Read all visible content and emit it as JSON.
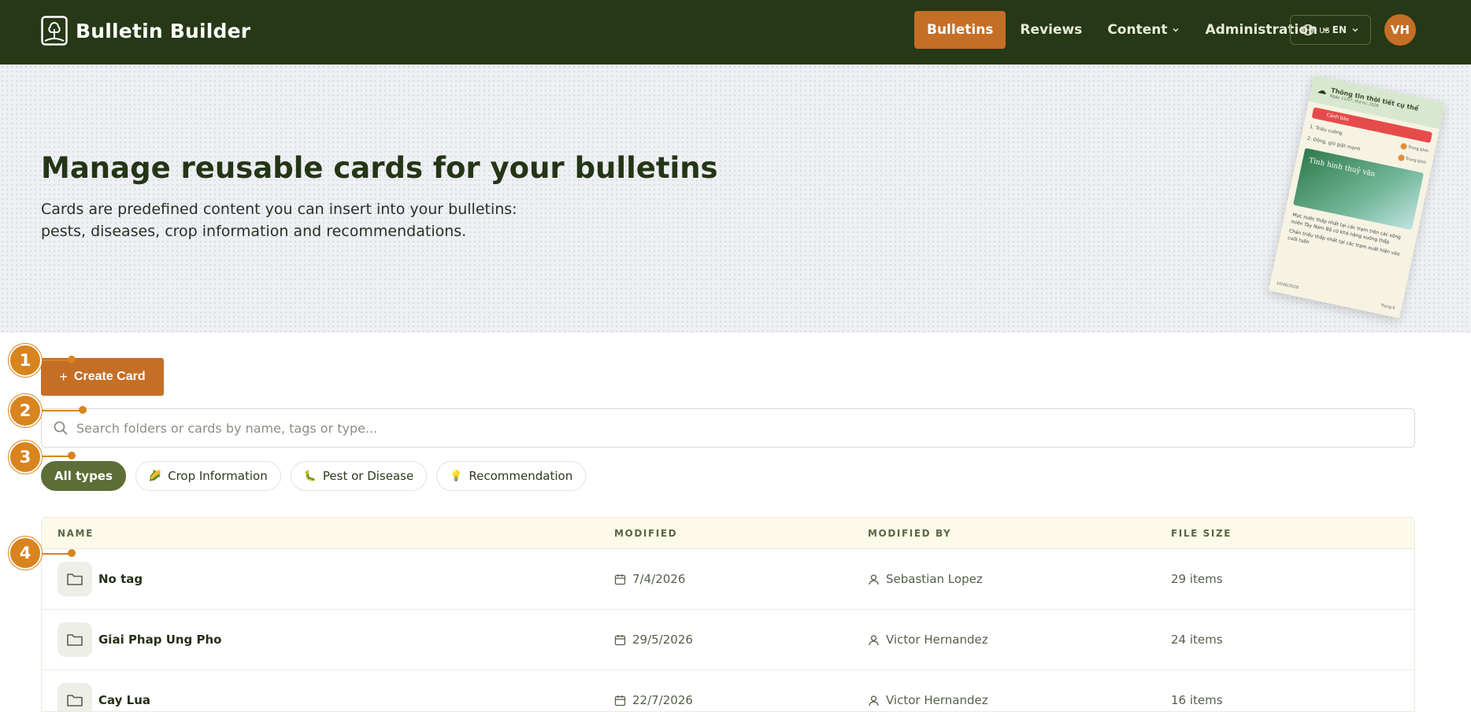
{
  "brand": {
    "name": "Bulletin Builder"
  },
  "nav": {
    "items": [
      {
        "label": "Bulletins",
        "active": true,
        "has_menu": false
      },
      {
        "label": "Reviews",
        "active": false,
        "has_menu": false
      },
      {
        "label": "Content",
        "active": false,
        "has_menu": true
      },
      {
        "label": "Administration",
        "active": false,
        "has_menu": true
      }
    ],
    "language": {
      "region": "us",
      "code": "EN"
    },
    "avatar_initials": "VH"
  },
  "hero": {
    "title": "Manage reusable cards for your bulletins",
    "description": "Cards are predefined content you can insert into your bulletins: pests, diseases, crop information and recommendations.",
    "preview": {
      "title": "Thông tin thời tiết cụ thể",
      "subtitle": "Ngày 11/07, thứ tư, 2026",
      "warning": "Cảnh báo",
      "lines": [
        "1. Triều cường",
        "2. Dông, gió giật mạnh"
      ],
      "line_tags": [
        "Trung bình",
        "Trung bình"
      ],
      "image_caption": "Tình hình thuỷ văn",
      "bullets": [
        "Mực nước thấp nhất tại các trạm trên các sông miền Tây Nam Bộ có khả năng xuống thấp",
        "Chân triều thấp nhất tại các trạm xuất hiện vào cuối tuần"
      ],
      "footer_left": "10/06/2026",
      "footer_right": "Trang 6"
    }
  },
  "actions": {
    "create_label": "Create Card"
  },
  "search": {
    "placeholder": "Search folders or cards by name, tags or type..."
  },
  "filters": [
    {
      "label": "All types",
      "icon": "",
      "active": true
    },
    {
      "label": "Crop Information",
      "icon": "corn-icon",
      "active": false
    },
    {
      "label": "Pest or Disease",
      "icon": "bug-icon",
      "active": false
    },
    {
      "label": "Recommendation",
      "icon": "lightbulb-icon",
      "active": false
    }
  ],
  "table": {
    "columns": [
      "NAME",
      "MODIFIED",
      "MODIFIED BY",
      "FILE SIZE"
    ],
    "rows": [
      {
        "name": "No tag",
        "modified": "7/4/2026",
        "modified_by": "Sebastian Lopez",
        "size": "29 items"
      },
      {
        "name": "Giai Phap Ung Pho",
        "modified": "29/5/2026",
        "modified_by": "Victor Hernandez",
        "size": "24 items"
      },
      {
        "name": "Cay Lua",
        "modified": "22/7/2026",
        "modified_by": "Victor Hernandez",
        "size": "16 items"
      }
    ]
  },
  "markers": [
    "1",
    "2",
    "3",
    "4"
  ],
  "colors": {
    "nav_bg": "#263816",
    "accent": "#c56e26",
    "chip_active": "#5d6e37",
    "marker": "#d8841f"
  }
}
